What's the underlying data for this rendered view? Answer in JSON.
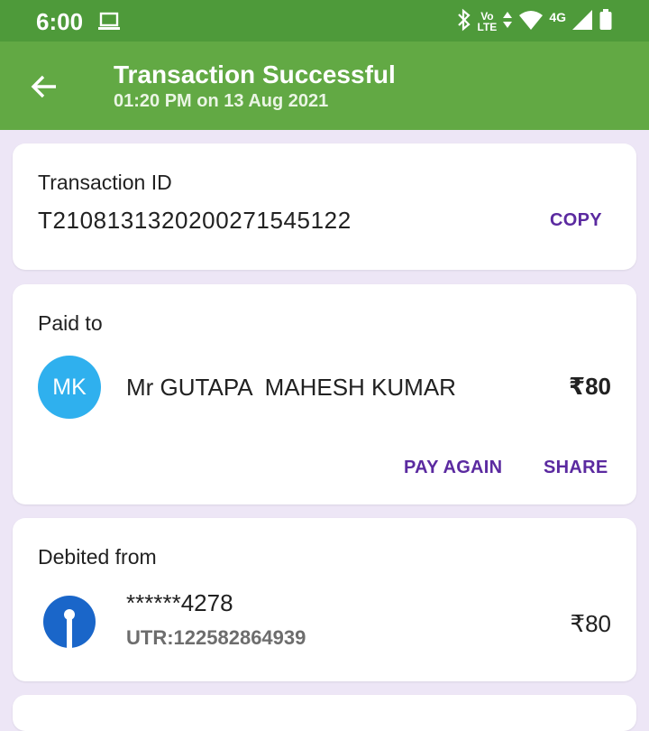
{
  "status_bar": {
    "time": "6:00",
    "volte_line1": "Vo",
    "volte_line2": "LTE",
    "network": "4G"
  },
  "app_bar": {
    "title": "Transaction Successful",
    "subtitle": "01:20 PM on 13 Aug 2021"
  },
  "transaction_card": {
    "heading": "Transaction ID",
    "transaction_id": "T2108131320200271545122",
    "copy_label": "COPY"
  },
  "paid_to_card": {
    "heading": "Paid to",
    "avatar_initials": "MK",
    "payee_name": "Mr GUTAPA  MAHESH KUMAR",
    "amount": "₹80",
    "pay_again_label": "PAY AGAIN",
    "share_label": "SHARE"
  },
  "debited_card": {
    "heading": "Debited from",
    "account_number": "******4278",
    "utr": "UTR:122582864939",
    "amount": "₹80"
  },
  "colors": {
    "status_bar": "#4e9a3a",
    "app_bar": "#62a944",
    "accent": "#5b2aa0",
    "avatar": "#2fb0ee",
    "bank_logo": "#1a66c9",
    "background": "#ede6f6"
  }
}
